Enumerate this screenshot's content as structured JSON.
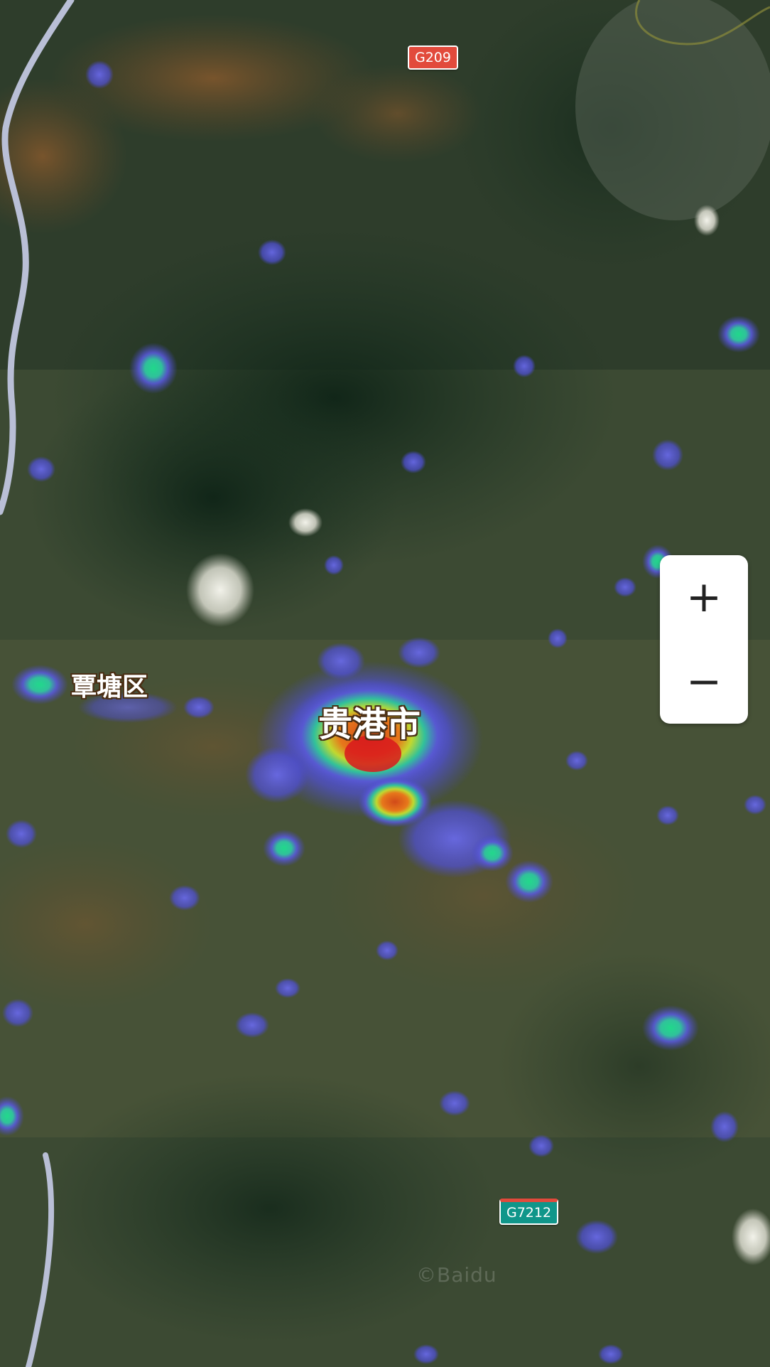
{
  "map": {
    "layer": "satellite",
    "overlay": "heatmap",
    "heatmap_colors": {
      "low": "#5a5adc",
      "medium": "#2ec4a0",
      "high": "#f5e400",
      "higher": "#f07a1a",
      "peak": "#e0151c"
    }
  },
  "labels": {
    "city": "贵港市",
    "district": "覃塘区"
  },
  "road_shields": {
    "north": "G209",
    "south": "G7212"
  },
  "watermark": "©Baidu",
  "zoom": {
    "in_symbol": "+",
    "out_symbol": "−"
  }
}
